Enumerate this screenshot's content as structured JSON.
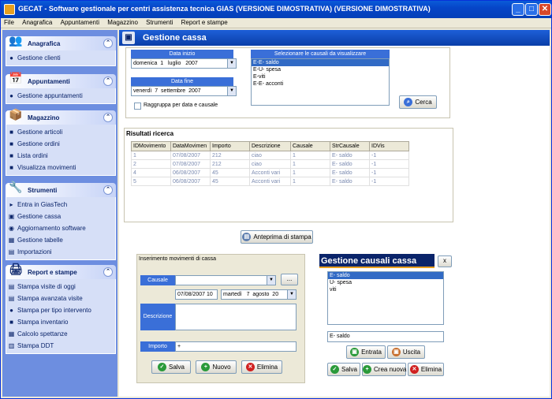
{
  "window": {
    "title": "GECAT - Software gestionale per centri assistenza tecnica GIAS (VERSIONE DIMOSTRATIVA)  (VERSIONE DIMOSTRATIVA)"
  },
  "menu": [
    "File",
    "Anagrafica",
    "Appuntamenti",
    "Magazzino",
    "Strumenti",
    "Report e stampe"
  ],
  "sidebar": {
    "anagrafica": {
      "title": "Anagrafica",
      "items": [
        "Gestione clienti"
      ]
    },
    "appuntamenti": {
      "title": "Appuntamenti",
      "items": [
        "Gestione appuntamenti"
      ]
    },
    "magazzino": {
      "title": "Magazzino",
      "items": [
        "Gestione articoli",
        "Gestione ordini",
        "Lista ordini",
        "Visualizza movimenti"
      ]
    },
    "strumenti": {
      "title": "Strumenti",
      "items": [
        "Entra in GiasTech",
        "Gestione cassa",
        "Aggiornamento software",
        "Gestione tabelle",
        "Importazioni"
      ]
    },
    "report": {
      "title": "Report e stampe",
      "items": [
        "Stampa visite di oggi",
        "Stampa avanzata visite",
        "Stampa per tipo intervento",
        "Stampa inventario",
        "Calcolo spettanze",
        "Stampa DDT"
      ]
    }
  },
  "main": {
    "title": "Gestione cassa"
  },
  "filters": {
    "data_inizio_label": "Data inizio",
    "data_inizio": {
      "weekday": "domenica",
      "day": "1",
      "month": "luglio",
      "year": "2007"
    },
    "data_fine_label": "Data fine",
    "data_fine": {
      "weekday": "venerdì",
      "day": "7",
      "month": "settembre",
      "year": "2007"
    },
    "raggruppa_label": "Raggruppa per data e causale",
    "causali_label": "Selezionare le causali da visualizzare",
    "causali": [
      "E-E- saldo",
      "E-U- spesa",
      "E-viti",
      "E-E- acconti"
    ],
    "cerca_label": "Cerca"
  },
  "results": {
    "title": "Risultati ricerca",
    "columns": [
      "IDMovimento",
      "DataMovimen",
      "Importo",
      "Descrizione",
      "Causale",
      "StrCausale",
      "IDVis"
    ],
    "rows": [
      [
        "1",
        "07/08/2007",
        "212",
        "ciao",
        "1",
        "E- saldo",
        "-1"
      ],
      [
        "2",
        "07/08/2007",
        "212",
        "ciao",
        "1",
        "E- saldo",
        "-1"
      ],
      [
        "4",
        "06/08/2007",
        "45",
        "Acconti vari",
        "1",
        "E- saldo",
        "-1"
      ],
      [
        "5",
        "06/08/2007",
        "45",
        "Acconti vari",
        "1",
        "E- saldo",
        "-1"
      ]
    ],
    "anteprima_label": "Anteprima di stampa"
  },
  "inserimento": {
    "title": "Inserimento movimenti di cassa",
    "causale_label": "Causale",
    "dots_label": "...",
    "date_value": "07/08/2007 10",
    "date_weekday": "martedì",
    "date_day": "7",
    "date_month": "agosto",
    "date_year": "20",
    "descrizione_label": "Descrizione",
    "importo_label": "Importo",
    "importo_value": "+",
    "salva_label": "Salva",
    "nuovo_label": "Nuovo",
    "elimina_label": "Elimina"
  },
  "causali_panel": {
    "title": "Gestione causali cassa",
    "close_label": "x",
    "items": [
      "E- saldo",
      "U- spesa",
      "viti"
    ],
    "selected_value": "E- saldo",
    "entrata_label": "Entrata",
    "uscita_label": "Uscita",
    "salva_label": "Salva",
    "crea_label": "Crea nuova",
    "elimina_label": "Elimina"
  }
}
